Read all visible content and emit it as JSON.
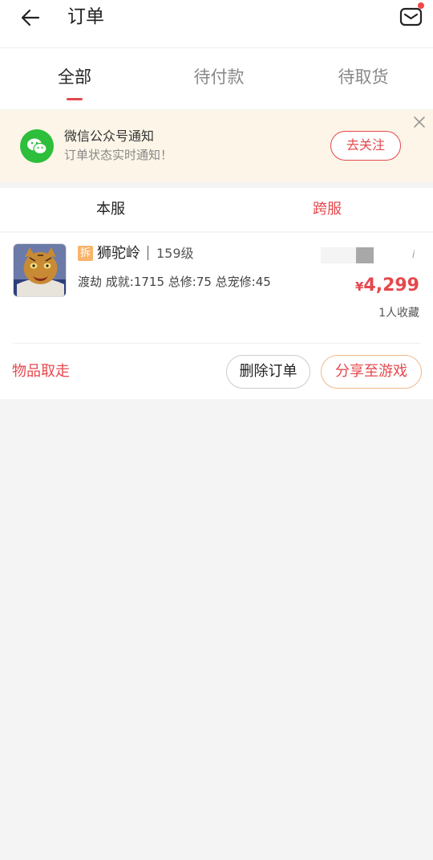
{
  "header": {
    "title": "订单",
    "back_icon": "back-arrow-icon",
    "mail_icon": "mail-icon",
    "has_notification_dot": true
  },
  "tabs": [
    {
      "label": "全部",
      "active": true
    },
    {
      "label": "待付款",
      "active": false
    },
    {
      "label": "待取货",
      "active": false
    }
  ],
  "notice": {
    "icon": "wechat-icon",
    "title": "微信公众号通知",
    "subtitle": "订单状态实时通知！",
    "button_label": "去关注",
    "close_icon": "close-icon"
  },
  "server_tabs": [
    {
      "label": "本服",
      "active": false
    },
    {
      "label": "跨服",
      "active": true
    }
  ],
  "order": {
    "tag": "拆",
    "name": "狮驼岭",
    "level": "159级",
    "stats": "渡劫 成就:1715 总修:75 总宠修:45",
    "price_symbol": "¥",
    "price": "4,299",
    "favorites": "1人收藏",
    "status": "物品取走",
    "delete_label": "删除订单",
    "share_label": "分享至游戏"
  },
  "colors": {
    "accent": "#e5484d",
    "notice_bg": "#fdf6e8",
    "wechat_green": "#2dbe3c"
  }
}
